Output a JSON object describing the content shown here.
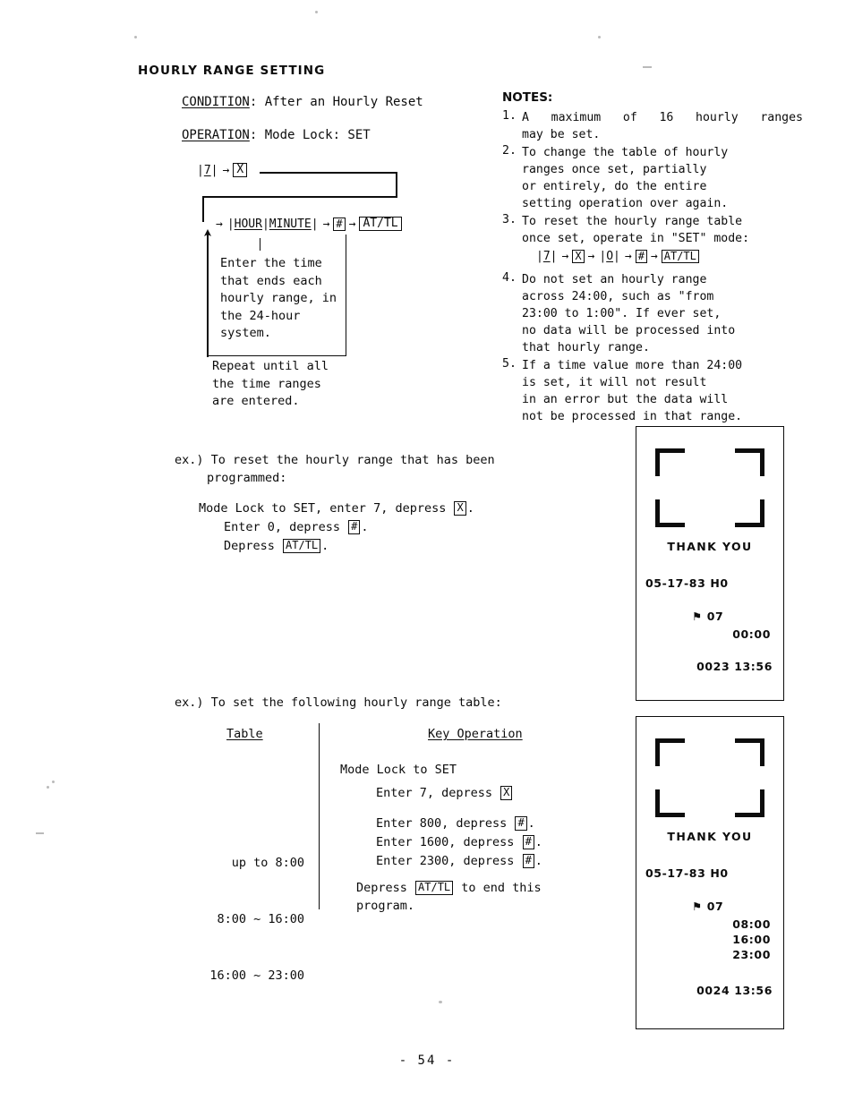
{
  "section": {
    "title": "HOURLY RANGE SETTING"
  },
  "condition": {
    "label": "CONDITION",
    "separator": ": ",
    "value": "After an Hourly Reset"
  },
  "operation": {
    "label": "OPERATION",
    "separator": ": ",
    "value": "Mode Lock: SET"
  },
  "flow": {
    "row1": {
      "key_7": "7",
      "arrow": "→",
      "key_x": "X"
    },
    "row2": {
      "arrow_in": "→",
      "hour": "HOUR",
      "minute": "MINUTE",
      "arrow_1": "→",
      "key_hash": "#",
      "arrow_2": "→",
      "key_attl": "AT/TL"
    },
    "explanation": "Enter the time\nthat ends each\nhourly range, in\nthe 24-hour\nsystem.",
    "repeat": "Repeat until all\nthe time ranges\nare entered."
  },
  "notes": {
    "title": "NOTES:",
    "items": [
      {
        "num": "1.",
        "text": "A maximum of 16 hourly ranges may be set.",
        "lines": [
          "A  maximum  of  16  hourly  ranges",
          "may be set."
        ]
      },
      {
        "num": "2.",
        "text": "To change the table of hourly ranges once set, partially or entirely, do the entire setting operation over again.",
        "lines": [
          "To  change  the  table  of  hourly",
          "ranges    once    set,    partially",
          "or   entirely,   do   the   entire",
          "setting operation over again."
        ]
      },
      {
        "num": "3.",
        "text": "To reset the hourly range table once set, operate in \"SET\" mode:",
        "lines": [
          "To reset the hourly range table",
          "once set, operate in \"SET\" mode:"
        ],
        "sequence": {
          "key_7": "7",
          "key_x": "X",
          "key_0": "O",
          "key_hash": "#",
          "key_attl": "AT/TL",
          "arrow": "→"
        }
      },
      {
        "num": "4.",
        "text": "Do not set an hourly range across 24:00, such as \"from 23:00 to 1:00\". If ever set, no data will be processed into that hourly range.",
        "lines": [
          "Do   not   set   an   hourly   range",
          "across  24:00,  such  as  \"from",
          "23:00 to 1:00\".  If ever set,",
          "no data will be processed into",
          "that hourly range."
        ]
      },
      {
        "num": "5.",
        "text": "If a time value more than 24:00 is set, it will not result in an error but the data will not be processed in that range.",
        "lines": [
          "If a time value more than 24:00",
          "is  set,  it  will  not  result",
          "in an error but the data will",
          "not be processed in that range."
        ]
      }
    ]
  },
  "example1": {
    "intro_line1": "ex.) To reset the hourly range that has been",
    "intro_line2": "programmed:",
    "step1_pre": "Mode Lock to SET, enter 7, depress ",
    "step1_key": "X",
    "step1_post": ".",
    "step2_pre": "Enter 0, depress ",
    "step2_key": "#",
    "step2_post": ".",
    "step3_pre": "Depress ",
    "step3_key": "AT/TL",
    "step3_post": "."
  },
  "example2": {
    "intro": "ex.) To set the following hourly range table:",
    "col_table_header": "Table",
    "col_keyop_header": "Key Operation",
    "table_rows": [
      "up to 8:00",
      "8:00 ~ 16:00",
      "16:00 ~ 23:00"
    ],
    "keyop_modelock": "Mode Lock to SET",
    "keyop_enter7_pre": "Enter 7, depress ",
    "keyop_enter7_key": "X",
    "enter_rows": [
      {
        "pre": "Enter 800, depress ",
        "key": "#",
        "post": "."
      },
      {
        "pre": "Enter 1600, depress ",
        "key": "#",
        "post": "."
      },
      {
        "pre": "Enter 2300, depress ",
        "key": "#",
        "post": "."
      }
    ],
    "depress_pre": "Depress ",
    "depress_key": "AT/TL",
    "depress_post": " to end this",
    "depress_line2": "program."
  },
  "receipts": [
    {
      "id": "receipt-1",
      "thanks": "THANK  YOU",
      "date": "05-17-83 Н0",
      "flag": "⚑ 07",
      "times": [
        "00:00"
      ],
      "counter": "0023 13:56"
    },
    {
      "id": "receipt-2",
      "thanks": "THANK  YOU",
      "date": "05-17-83 Н0",
      "flag": "⚑ 07",
      "times": [
        "08:00",
        "16:00",
        "23:00"
      ],
      "counter": "0024 13:56"
    }
  ],
  "footer": {
    "page_number": "- 54 -"
  }
}
